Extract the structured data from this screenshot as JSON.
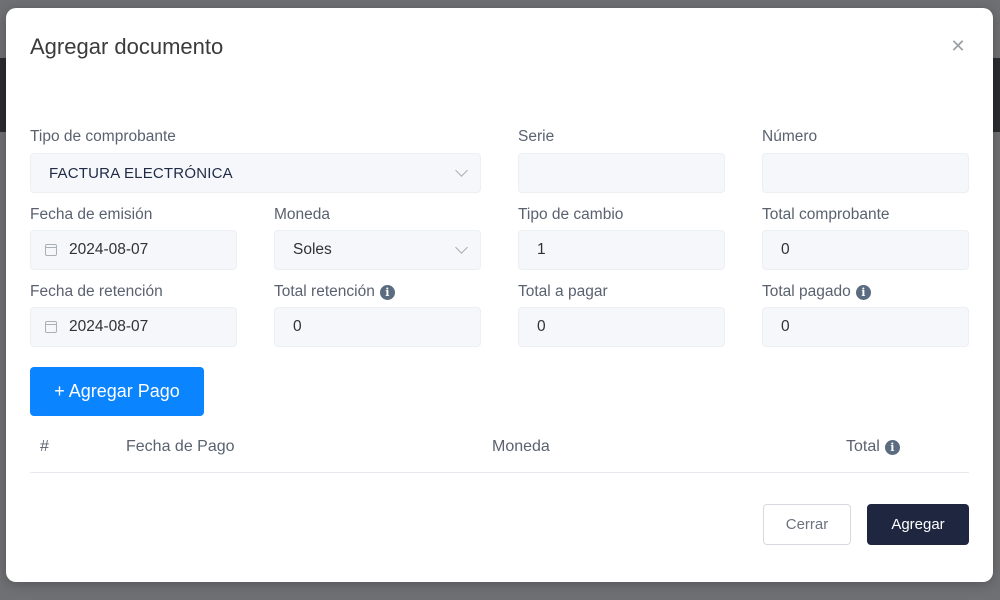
{
  "modal": {
    "title": "Agregar documento",
    "close_glyph": "✕"
  },
  "form": {
    "tipo_comprobante": {
      "label": "Tipo de comprobante",
      "value": "FACTURA ELECTRÓNICA"
    },
    "serie": {
      "label": "Serie",
      "value": ""
    },
    "numero": {
      "label": "Número",
      "value": ""
    },
    "fecha_emision": {
      "label": "Fecha de emisión",
      "value": "2024-08-07"
    },
    "moneda": {
      "label": "Moneda",
      "value": "Soles"
    },
    "tipo_cambio": {
      "label": "Tipo de cambio",
      "value": "1"
    },
    "total_comprobante": {
      "label": "Total comprobante",
      "value": "0"
    },
    "fecha_retencion": {
      "label": "Fecha de retención",
      "value": "2024-08-07"
    },
    "total_retencion": {
      "label": "Total retención",
      "value": "0"
    },
    "total_a_pagar": {
      "label": "Total a pagar",
      "value": "0"
    },
    "total_pagado": {
      "label": "Total pagado",
      "value": "0"
    }
  },
  "payments": {
    "add_button_label": "+ Agregar Pago",
    "columns": [
      "#",
      "Fecha de Pago",
      "Moneda",
      "Total"
    ],
    "rows": []
  },
  "footer": {
    "close_label": "Cerrar",
    "submit_label": "Agregar"
  },
  "icons": {
    "info": "i"
  },
  "colors": {
    "primary": "#0a84ff",
    "submit": "#1f2740",
    "field_bg": "#f5f7fa"
  }
}
